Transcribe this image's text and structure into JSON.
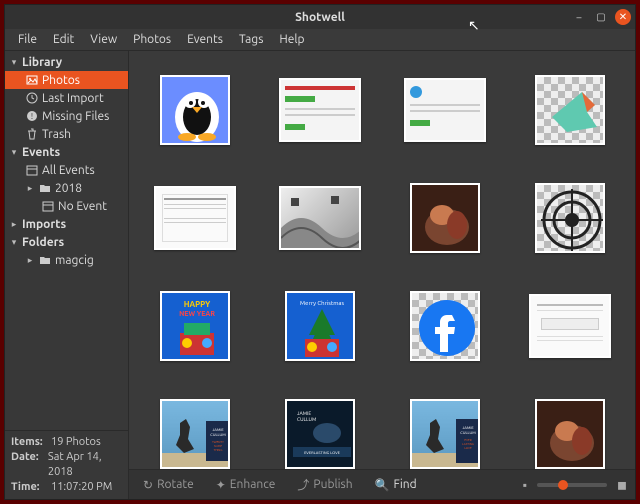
{
  "window": {
    "title": "Shotwell"
  },
  "menu": {
    "items": [
      "File",
      "Edit",
      "View",
      "Photos",
      "Events",
      "Tags",
      "Help"
    ]
  },
  "sidebar": {
    "library": "Library",
    "photos": "Photos",
    "last_import": "Last Import",
    "missing": "Missing Files",
    "trash": "Trash",
    "events": "Events",
    "all_events": "All Events",
    "year": "2018",
    "no_event": "No Event",
    "imports": "Imports",
    "folders": "Folders",
    "folder1": "magcig"
  },
  "info": {
    "items_label": "Items:",
    "items_value": "19 Photos",
    "date_label": "Date:",
    "date_value": "Sat Apr 14, 2018",
    "time_label": "Time:",
    "time_value": "11:07:20 PM"
  },
  "toolbar": {
    "rotate": "Rotate",
    "enhance": "Enhance",
    "publish": "Publish",
    "find": "Find"
  }
}
